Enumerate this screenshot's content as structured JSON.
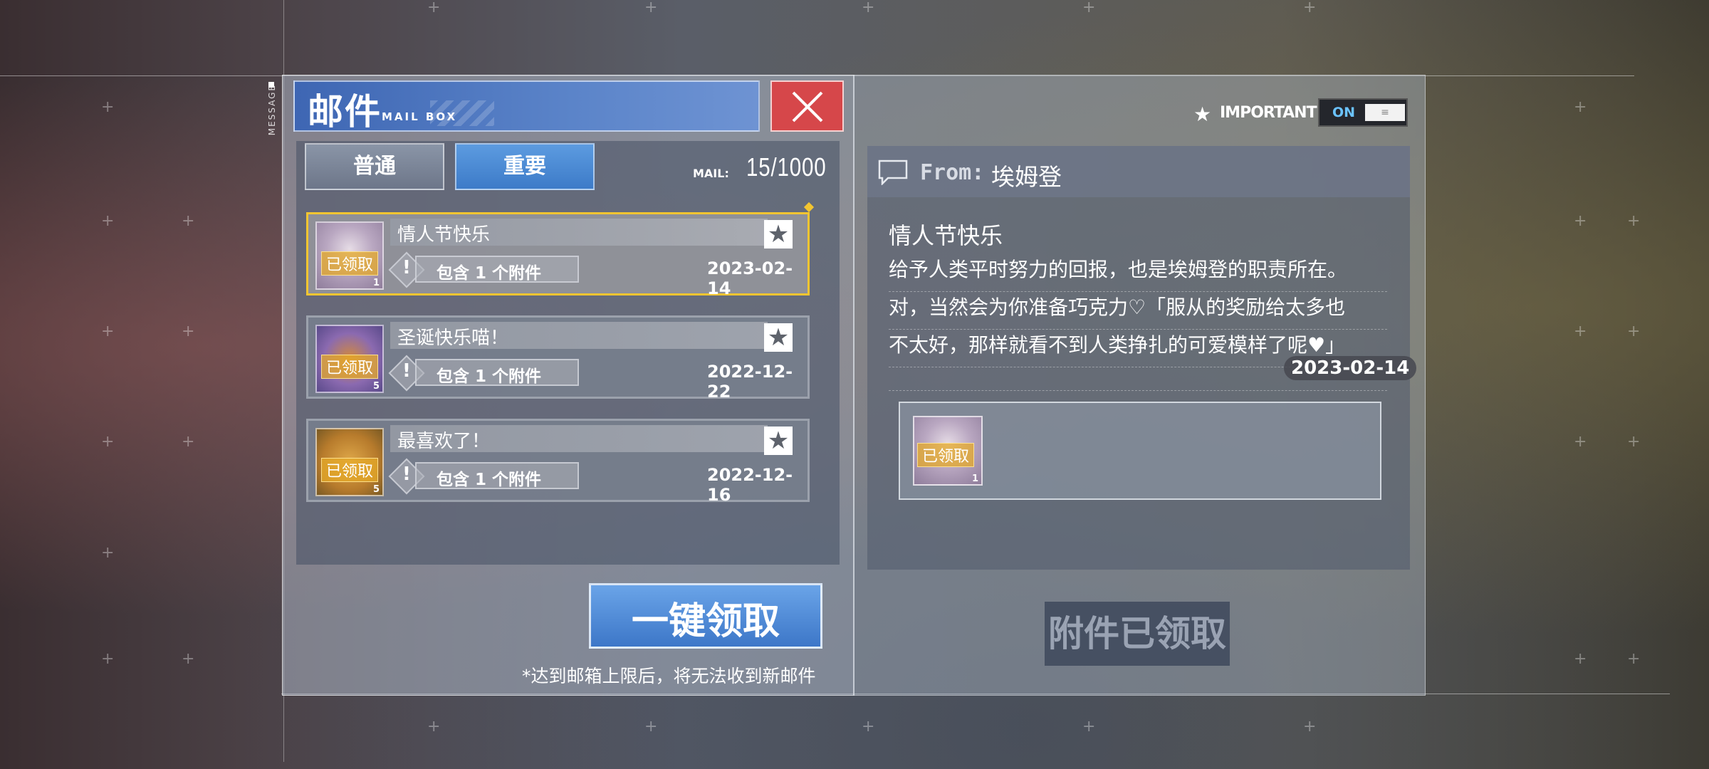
{
  "window": {
    "side_label": "MESSAGE"
  },
  "header": {
    "title": "邮件",
    "subtitle": "MAIL BOX"
  },
  "tabs": [
    {
      "label": "普通",
      "active": false
    },
    {
      "label": "重要",
      "active": true
    }
  ],
  "mail_count": {
    "label": "MAIL:",
    "value": "15/1000"
  },
  "mails": [
    {
      "title": "情人节快乐",
      "attachment_text": "包含 1 个附件",
      "date": "2023-02-14",
      "stamp": "已领取",
      "qty": "1",
      "thumb_icon": "girl-portrait-icon",
      "selected": true
    },
    {
      "title": "圣诞快乐喵！",
      "attachment_text": "包含 1 个附件",
      "date": "2022-12-22",
      "stamp": "已领取",
      "qty": "5",
      "thumb_icon": "gift-box-icon",
      "selected": false
    },
    {
      "title": "最喜欢了！",
      "attachment_text": "包含 1 个附件",
      "date": "2022-12-16",
      "stamp": "已领取",
      "qty": "5",
      "thumb_icon": "treasure-chest-icon",
      "selected": false
    }
  ],
  "actions": {
    "claim_all": "一键领取",
    "limit_note": "*达到邮箱上限后，将无法收到新邮件"
  },
  "important_filter": {
    "label": "IMPORTANT",
    "state": "ON"
  },
  "detail": {
    "from_label": "From:",
    "from_name": "埃姆登",
    "title": "情人节快乐",
    "body_lines": [
      "给予人类平时努力的回报，也是埃姆登的职责所在。",
      "对，当然会为你准备巧克力♡「服从的奖励给太多也",
      "不太好，那样就看不到人类挣扎的可爱模样了呢♥」"
    ],
    "date": "2023-02-14",
    "attachment": {
      "stamp": "已领取",
      "qty": "1",
      "icon": "girl-portrait-icon"
    },
    "claimed_button": "附件已领取"
  },
  "colors": {
    "accent_blue": "#3d7bc8",
    "close_red": "#d6474a",
    "selected_gold": "#f2c531",
    "toggle_on": "#6bc3ff"
  }
}
